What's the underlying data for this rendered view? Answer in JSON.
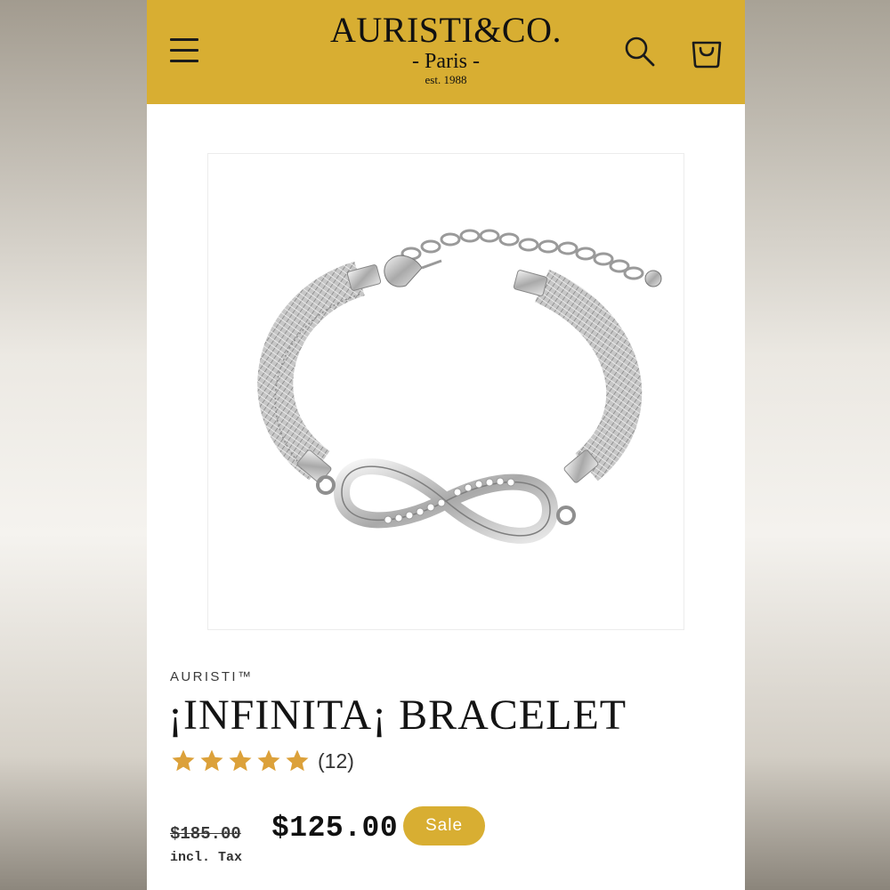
{
  "header": {
    "logo": {
      "name": "AURISTI&CO.",
      "city": "- Paris -",
      "established": "est. 1988"
    },
    "menu_icon": "hamburger-menu-icon",
    "search_icon": "search-icon",
    "cart_icon": "cart-bag-icon",
    "background_color": "#d8ae32"
  },
  "product": {
    "image_subject": "silver mesh bracelet with rhinestone infinity charm",
    "vendor": "AURISTI™",
    "title": "¡INFINITA¡ BRACELET",
    "rating": {
      "stars": 5,
      "max_stars": 5,
      "review_count_label": "(12)",
      "star_color": "#dca13a"
    },
    "price": {
      "compare_at": "$185.00",
      "sale": "$125.00",
      "badge": "Sale",
      "tax_note": "incl. Tax"
    }
  }
}
